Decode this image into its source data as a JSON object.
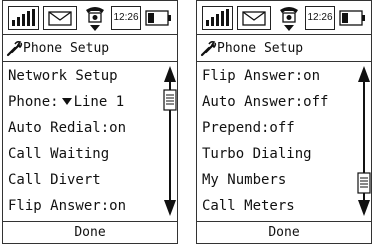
{
  "screens": [
    {
      "status": {
        "time": "12:26",
        "icons": [
          "signal-strength-icon",
          "envelope-icon",
          "phone-icon",
          "battery-icon"
        ]
      },
      "title": "Phone Setup",
      "title_icon": "wrench-icon",
      "items": [
        {
          "label": "Network Setup"
        },
        {
          "label": "Phone:",
          "value": "Line 1",
          "dropdown": true
        },
        {
          "label": "Auto Redial:on"
        },
        {
          "label": "Call Waiting"
        },
        {
          "label": "Call Divert"
        },
        {
          "label": "Flip Answer:on"
        }
      ],
      "scroll_position": "top",
      "footer": "Done"
    },
    {
      "status": {
        "time": "12:26",
        "icons": [
          "signal-strength-icon",
          "envelope-icon",
          "phone-icon",
          "battery-icon"
        ]
      },
      "title": "Phone Setup",
      "title_icon": "wrench-icon",
      "items": [
        {
          "label": "Flip Answer:on"
        },
        {
          "label": "Auto Answer:off"
        },
        {
          "label": "Prepend:off"
        },
        {
          "label": "Turbo Dialing"
        },
        {
          "label": "My Numbers"
        },
        {
          "label": "Call Meters"
        }
      ],
      "scroll_position": "bottom",
      "footer": "Done"
    }
  ]
}
